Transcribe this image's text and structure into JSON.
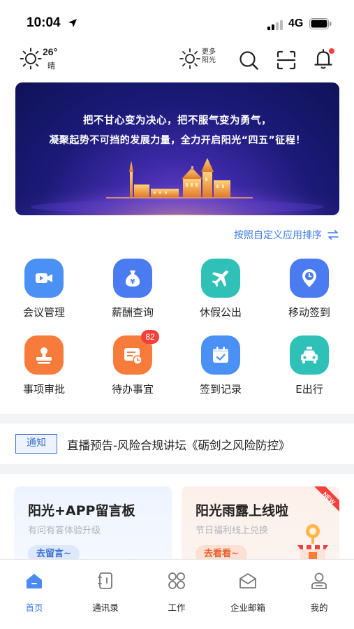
{
  "status_bar": {
    "time": "10:04",
    "network": "4G"
  },
  "toolbar": {
    "temperature": "26°",
    "condition": "晴",
    "more_sunshine": "更多阳光"
  },
  "banner": {
    "line1": "把不甘心变为决心，把不服气变为勇气，",
    "line2": "凝聚起势不可挡的发展力量，全力开启阳光“四五”征程！"
  },
  "sort_link": "按照自定义应用排序",
  "apps": [
    {
      "label": "会议管理",
      "icon": "video-camera-icon",
      "color": "#4a90f5"
    },
    {
      "label": "薪酬查询",
      "icon": "money-bag-icon",
      "color": "#4a7bf0"
    },
    {
      "label": "休假公出",
      "icon": "airplane-icon",
      "color": "#2fc1b8"
    },
    {
      "label": "移动签到",
      "icon": "location-clock-icon",
      "color": "#4a7bf0"
    },
    {
      "label": "事项审批",
      "icon": "stamp-icon",
      "color": "#f77b3a"
    },
    {
      "label": "待办事宜",
      "icon": "todo-card-icon",
      "color": "#f77b3a",
      "badge": "82"
    },
    {
      "label": "签到记录",
      "icon": "calendar-check-icon",
      "color": "#4a90f5"
    },
    {
      "label": "E出行",
      "icon": "taxi-icon",
      "color": "#2fc1b8"
    }
  ],
  "notice": {
    "tag": "通知",
    "text": "直播预告-风险合规讲坛《砺剑之风险防控》"
  },
  "cards": [
    {
      "title": "阳光+APP留言板",
      "subtitle": "有问有答体验升级",
      "button": "去留言~"
    },
    {
      "title": "阳光雨露上线啦",
      "subtitle": "节日福利线上兑换",
      "button": "去看看~",
      "ribbon": "NEW"
    }
  ],
  "tabs": [
    {
      "label": "首页",
      "active": true
    },
    {
      "label": "通讯录"
    },
    {
      "label": "工作"
    },
    {
      "label": "企业邮箱"
    },
    {
      "label": "我的"
    }
  ],
  "colors": {
    "accent": "#3c7ae6",
    "badge": "#f5403c"
  }
}
